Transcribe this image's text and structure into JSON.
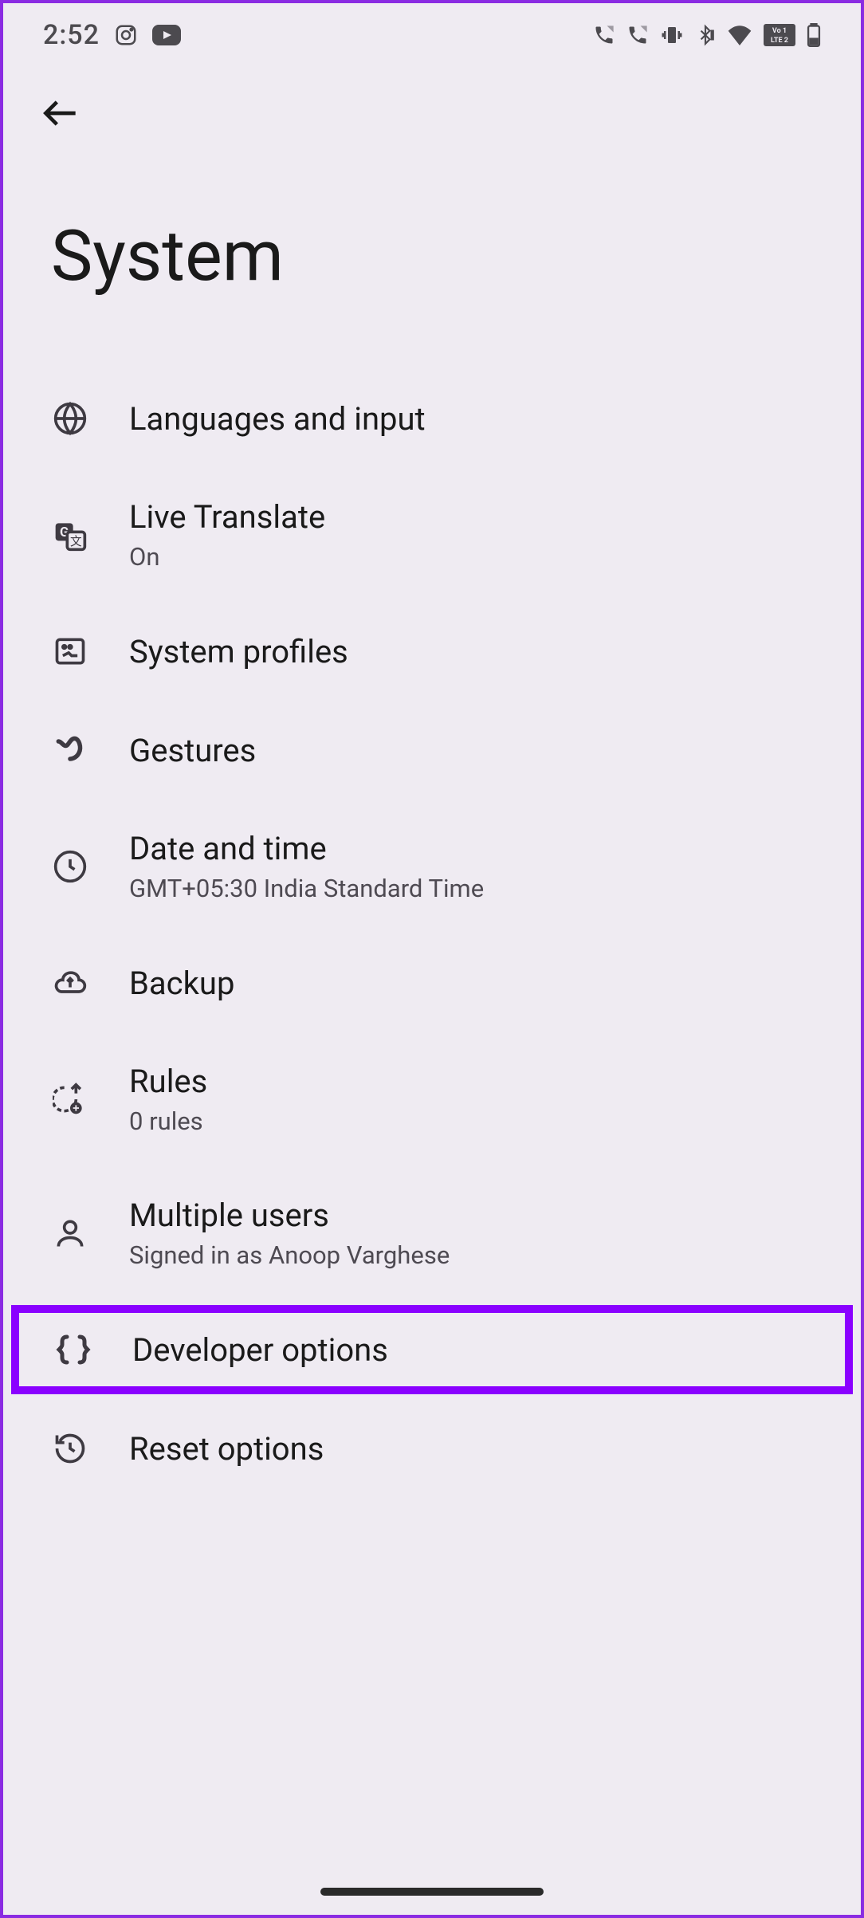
{
  "statusBar": {
    "time": "2:52"
  },
  "header": {
    "title": "System"
  },
  "items": [
    {
      "title": "Languages and input",
      "subtitle": ""
    },
    {
      "title": "Live Translate",
      "subtitle": "On"
    },
    {
      "title": "System profiles",
      "subtitle": ""
    },
    {
      "title": "Gestures",
      "subtitle": ""
    },
    {
      "title": "Date and time",
      "subtitle": "GMT+05:30 India Standard Time"
    },
    {
      "title": "Backup",
      "subtitle": ""
    },
    {
      "title": "Rules",
      "subtitle": "0 rules"
    },
    {
      "title": "Multiple users",
      "subtitle": "Signed in as Anoop Varghese"
    },
    {
      "title": "Developer options",
      "subtitle": ""
    },
    {
      "title": "Reset options",
      "subtitle": ""
    }
  ],
  "highlightColor": "#8a00ff"
}
